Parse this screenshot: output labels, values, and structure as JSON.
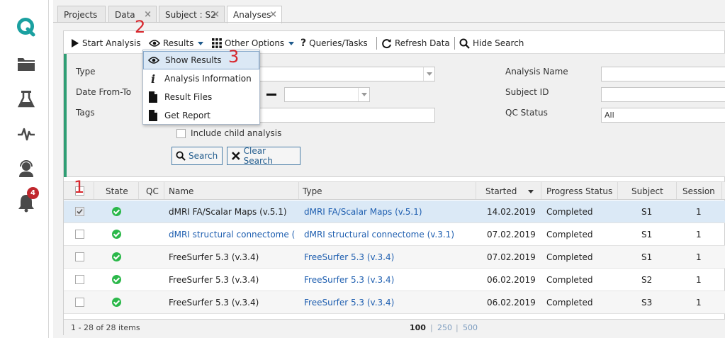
{
  "rail": {
    "icons": [
      "q-logo-icon",
      "folder-icon",
      "flask-icon",
      "pulse-icon",
      "support-agent-icon",
      "bell-icon"
    ],
    "notification_count": "4",
    "brand_color": "#1aa0a0"
  },
  "tabs": [
    {
      "label": "Projects",
      "closable": false
    },
    {
      "label": "Data",
      "closable": true
    },
    {
      "label": "Subject : S2",
      "closable": true
    },
    {
      "label": "Analyses",
      "closable": true,
      "active": true
    }
  ],
  "toolbar": {
    "start_analysis": "Start Analysis",
    "results": "Results",
    "other_options": "Other Options",
    "queries_tasks": "Queries/Tasks",
    "refresh_data": "Refresh Data",
    "hide_search": "Hide Search"
  },
  "results_menu": {
    "items": [
      "Show Results",
      "Analysis Information",
      "Result Files",
      "Get Report"
    ],
    "highlighted": "Show Results"
  },
  "search": {
    "type_label": "Type",
    "date_label": "Date From-To",
    "tags_label": "Tags",
    "include_child_label": "Include child analysis",
    "analysis_name_label": "Analysis Name",
    "subject_id_label": "Subject ID",
    "qc_status_label": "QC Status",
    "qc_status_value": "All",
    "search_button": "Search",
    "clear_button": "Clear Search"
  },
  "table": {
    "headers": [
      "State",
      "QC",
      "Name",
      "Type",
      "Started",
      "Progress Status",
      "Subject",
      "Session"
    ],
    "rows": [
      {
        "checked": true,
        "name": "dMRI FA/Scalar Maps (v.5.1)",
        "name_link": false,
        "type": "dMRI FA/Scalar Maps (v.5.1)",
        "started": "14.02.2019",
        "status": "Completed",
        "subject": "S1",
        "session": "1"
      },
      {
        "checked": false,
        "name": "dMRI structural connectome (…",
        "name_link": true,
        "type": "dMRI structural connectome (v.3.1)",
        "started": "07.02.2019",
        "status": "Completed",
        "subject": "S1",
        "session": "1"
      },
      {
        "checked": false,
        "name": "FreeSurfer 5.3 (v.3.4)",
        "name_link": false,
        "type": "FreeSurfer 5.3 (v.3.4)",
        "started": "07.02.2019",
        "status": "Completed",
        "subject": "S1",
        "session": "1"
      },
      {
        "checked": false,
        "name": "FreeSurfer 5.3 (v.3.4)",
        "name_link": false,
        "type": "FreeSurfer 5.3 (v.3.4)",
        "started": "06.02.2019",
        "status": "Completed",
        "subject": "S2",
        "session": "1"
      },
      {
        "checked": false,
        "name": "FreeSurfer 5.3 (v.3.4)",
        "name_link": false,
        "type": "FreeSurfer 5.3 (v.3.4)",
        "started": "06.02.2019",
        "status": "Completed",
        "subject": "S3",
        "session": "1"
      }
    ]
  },
  "footer": {
    "items_text": "1 - 28 of 28 items",
    "page_sizes": [
      "100",
      "250",
      "500"
    ],
    "active_page_size": "100"
  },
  "annotations": [
    "1",
    "2",
    "3"
  ]
}
